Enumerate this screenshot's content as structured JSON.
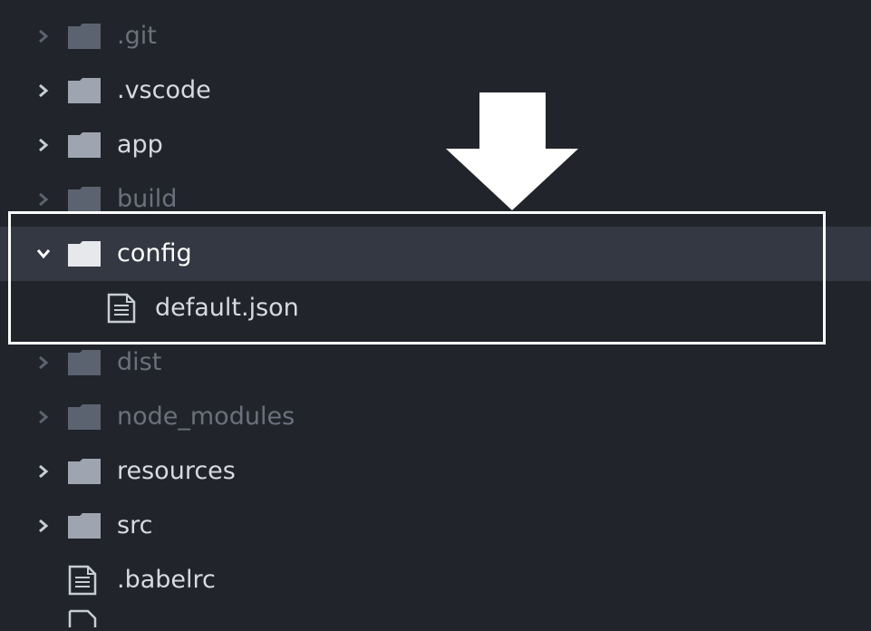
{
  "colors": {
    "background": "#21252b",
    "selected_row": "#333842",
    "text_bright": "#d7dae0",
    "text_dim": "#6b717c",
    "text_selected": "#ffffff",
    "highlight_border": "#ffffff",
    "arrow": "#ffffff"
  },
  "tree": {
    "items": [
      {
        "label": ".git",
        "type": "folder",
        "expanded": false,
        "dimmed": true,
        "icon": "folder-icon"
      },
      {
        "label": ".vscode",
        "type": "folder",
        "expanded": false,
        "dimmed": false,
        "icon": "folder-icon"
      },
      {
        "label": "app",
        "type": "folder",
        "expanded": false,
        "dimmed": false,
        "icon": "folder-icon"
      },
      {
        "label": "build",
        "type": "folder",
        "expanded": false,
        "dimmed": true,
        "icon": "folder-icon"
      },
      {
        "label": "config",
        "type": "folder",
        "expanded": true,
        "selected": true,
        "dimmed": false,
        "icon": "folder-open-icon"
      },
      {
        "label": "default.json",
        "type": "file",
        "nested": true,
        "dimmed": false,
        "icon": "file-text-icon"
      },
      {
        "label": "dist",
        "type": "folder",
        "expanded": false,
        "dimmed": true,
        "icon": "folder-icon"
      },
      {
        "label": "node_modules",
        "type": "folder",
        "expanded": false,
        "dimmed": true,
        "icon": "folder-icon"
      },
      {
        "label": "resources",
        "type": "folder",
        "expanded": false,
        "dimmed": false,
        "icon": "folder-icon"
      },
      {
        "label": "src",
        "type": "folder",
        "expanded": false,
        "dimmed": false,
        "icon": "folder-icon"
      },
      {
        "label": ".babelrc",
        "type": "file",
        "dimmed": false,
        "icon": "file-text-icon"
      }
    ]
  },
  "annotation": {
    "arrow_icon": "down-arrow-icon",
    "highlight": "highlight-box"
  }
}
